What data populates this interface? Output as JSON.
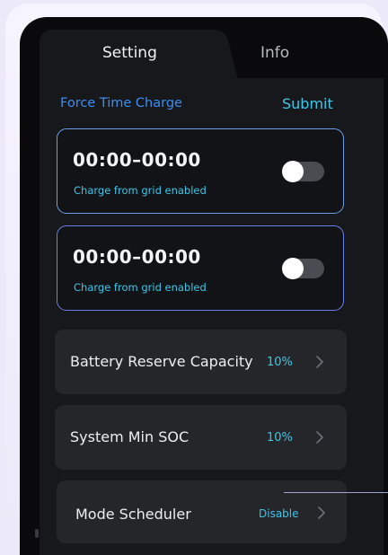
{
  "tabs": [
    {
      "label": "Setting",
      "active": true
    },
    {
      "label": "Info",
      "active": false
    }
  ],
  "force_charge": {
    "title": "Force Time Charge",
    "submit_label": "Submit",
    "slots": [
      {
        "time": "00:00–00:00",
        "subtitle": "Charge from grid enabled",
        "enabled": false
      },
      {
        "time": "00:00–00:00",
        "subtitle": "Charge from grid enabled",
        "enabled": false
      }
    ]
  },
  "settings": [
    {
      "label": "Battery Reserve Capacity",
      "value": "10%"
    },
    {
      "label": "System Min SOC",
      "value": "10%"
    },
    {
      "label": "Mode Scheduler",
      "value": "Disable"
    }
  ],
  "colors": {
    "accent_blue": "#3b8ff5",
    "accent_cyan": "#3fc6e8",
    "background": "#17181b"
  },
  "icons": {
    "chevron": "chevron-right-icon"
  }
}
